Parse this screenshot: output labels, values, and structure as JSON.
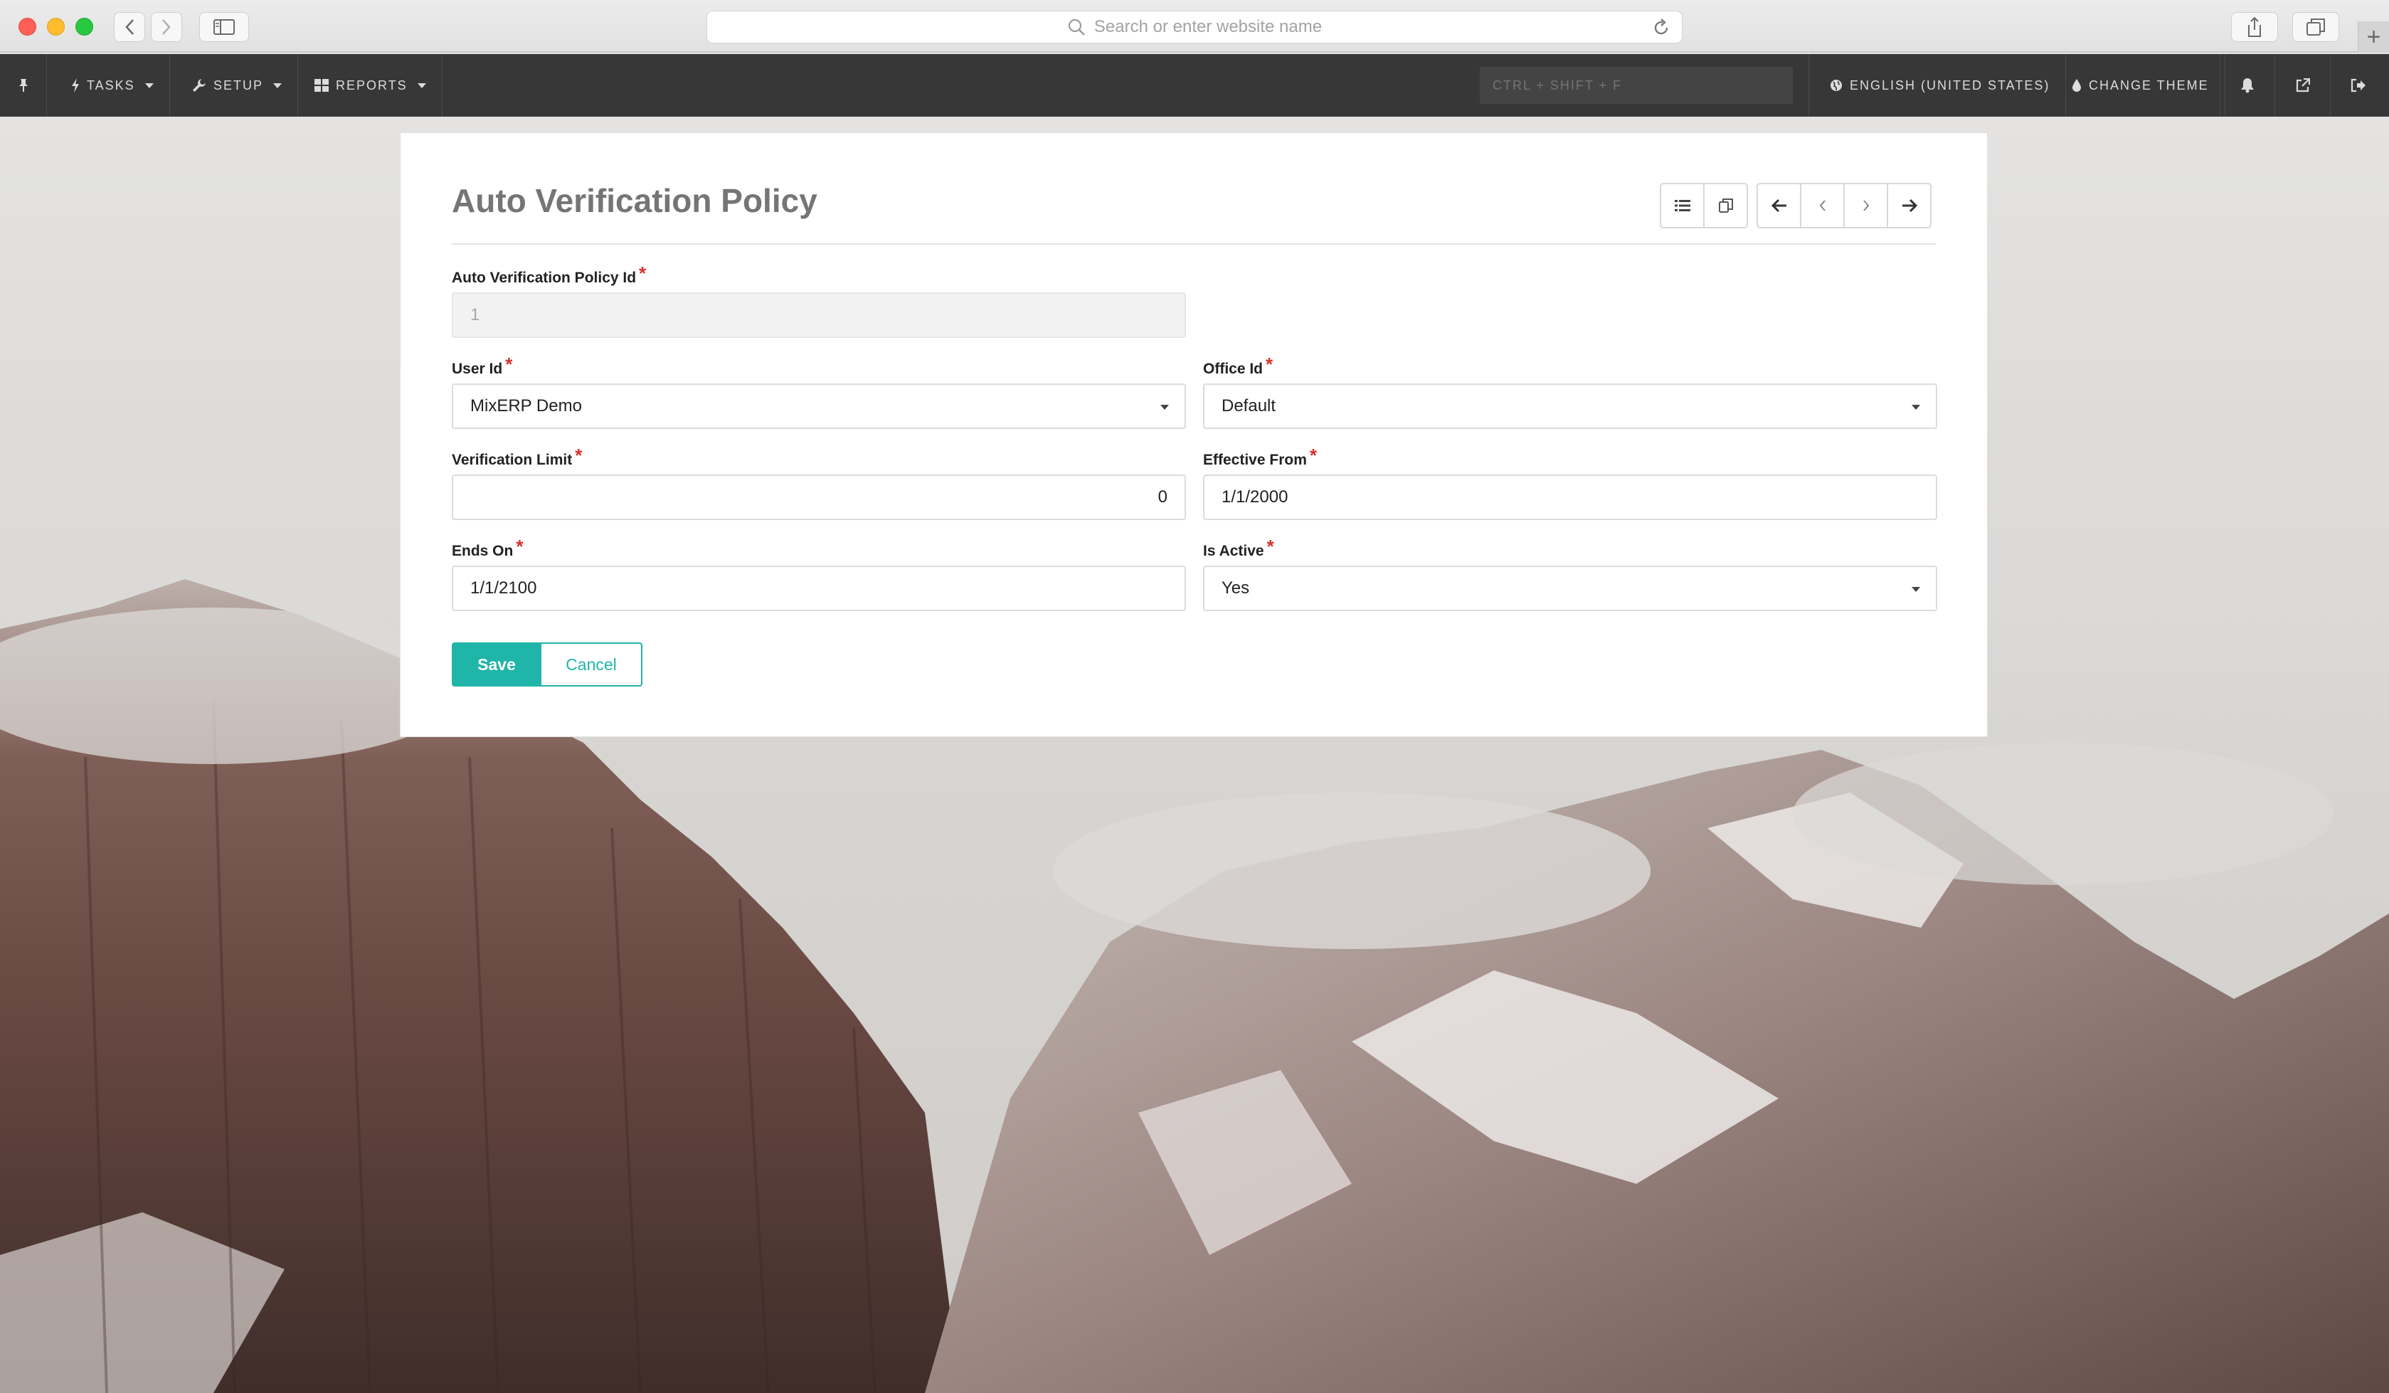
{
  "browser": {
    "address_placeholder": "Search or enter website name",
    "new_tab_symbol": "+"
  },
  "navbar": {
    "tasks_label": "TASKS",
    "setup_label": "SETUP",
    "reports_label": "REPORTS",
    "search_placeholder": "CTRL + SHIFT + F",
    "language_label": "ENGLISH (UNITED STATES)",
    "theme_label": "CHANGE THEME"
  },
  "form": {
    "title": "Auto Verification Policy",
    "required_marker": "*",
    "fields": {
      "policy_id": {
        "label": "Auto Verification Policy Id",
        "value": "1"
      },
      "user_id": {
        "label": "User Id",
        "value": "MixERP Demo"
      },
      "office_id": {
        "label": "Office Id",
        "value": "Default"
      },
      "verification_limit": {
        "label": "Verification Limit",
        "value": "0"
      },
      "effective_from": {
        "label": "Effective From",
        "value": "1/1/2000"
      },
      "ends_on": {
        "label": "Ends On",
        "value": "1/1/2100"
      },
      "is_active": {
        "label": "Is Active",
        "value": "Yes"
      }
    },
    "save_label": "Save",
    "cancel_label": "Cancel"
  },
  "colors": {
    "accent": "#1fb5a8",
    "navbar_bg": "#373737",
    "required": "#d9302c"
  },
  "icons": {
    "toolbar": [
      "list-icon",
      "copy-icon",
      "arrow-left-icon",
      "chevron-left-icon",
      "chevron-right-icon",
      "arrow-right-icon"
    ]
  }
}
